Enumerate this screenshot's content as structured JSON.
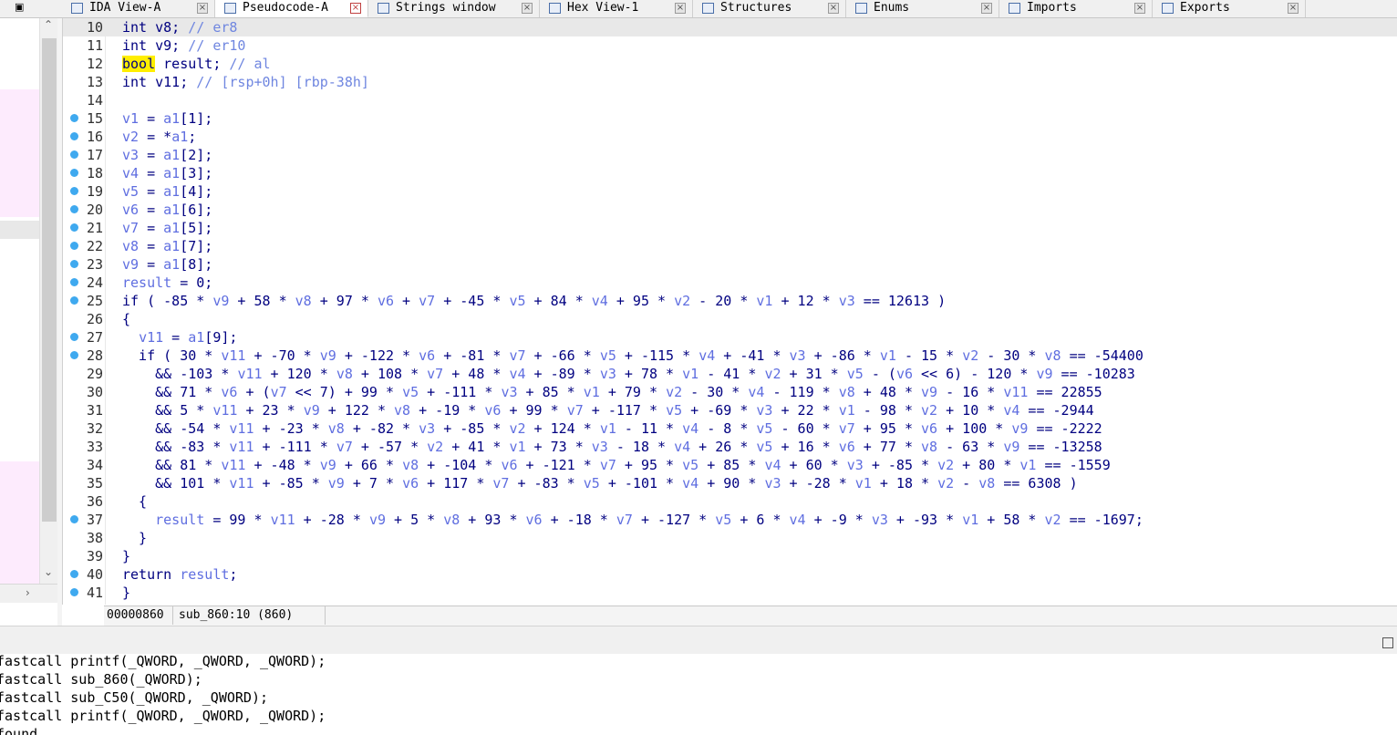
{
  "tabs": [
    {
      "label": "IDA View-A",
      "icon": "disassembly-view-icon",
      "active": false
    },
    {
      "label": "Pseudocode-A",
      "icon": "pseudocode-icon",
      "active": true
    },
    {
      "label": "Strings window",
      "icon": "strings-icon",
      "active": false
    },
    {
      "label": "Hex View-1",
      "icon": "hex-view-icon",
      "active": false
    },
    {
      "label": "Structures",
      "icon": "structures-icon",
      "active": false
    },
    {
      "label": "Enums",
      "icon": "enums-icon",
      "active": false
    },
    {
      "label": "Imports",
      "icon": "imports-icon",
      "active": false
    },
    {
      "label": "Exports",
      "icon": "exports-icon",
      "active": false
    }
  ],
  "close_glyph": "×",
  "restore_glyph": "▣",
  "left_arrows": {
    "up": "⌃",
    "down": "⌄",
    "right": "›"
  },
  "colors": {
    "breakpoint": "#3fa9ef",
    "highlight": "#ffee00",
    "keyword": "#000080",
    "variable": "#5f6ee0",
    "current_line": "#e8e8e8",
    "nav_pink": "#fdebfd"
  },
  "code_lines": [
    {
      "n": "10",
      "bp": false,
      "tokens": [
        [
          "int v8; ",
          "k"
        ],
        [
          "// er8",
          "c"
        ]
      ]
    },
    {
      "n": "11",
      "bp": false,
      "tokens": [
        [
          "int v9; ",
          "k"
        ],
        [
          "// er10",
          "c"
        ]
      ]
    },
    {
      "n": "12",
      "bp": false,
      "tokens": [
        [
          "bool",
          "h"
        ],
        [
          " result; ",
          "k"
        ],
        [
          "// al",
          "c"
        ]
      ]
    },
    {
      "n": "13",
      "bp": false,
      "tokens": [
        [
          "int v11; ",
          "k"
        ],
        [
          "// [rsp+0h] [rbp-38h]",
          "c"
        ]
      ]
    },
    {
      "n": "14",
      "bp": false,
      "tokens": []
    },
    {
      "n": "15",
      "bp": true,
      "tokens": [
        [
          "v1",
          "v"
        ],
        [
          " = ",
          "k"
        ],
        [
          "a1",
          "v"
        ],
        [
          "[1];",
          "k"
        ]
      ]
    },
    {
      "n": "16",
      "bp": true,
      "tokens": [
        [
          "v2",
          "v"
        ],
        [
          " = *",
          "k"
        ],
        [
          "a1",
          "v"
        ],
        [
          ";",
          "k"
        ]
      ]
    },
    {
      "n": "17",
      "bp": true,
      "tokens": [
        [
          "v3",
          "v"
        ],
        [
          " = ",
          "k"
        ],
        [
          "a1",
          "v"
        ],
        [
          "[2];",
          "k"
        ]
      ]
    },
    {
      "n": "18",
      "bp": true,
      "tokens": [
        [
          "v4",
          "v"
        ],
        [
          " = ",
          "k"
        ],
        [
          "a1",
          "v"
        ],
        [
          "[3];",
          "k"
        ]
      ]
    },
    {
      "n": "19",
      "bp": true,
      "tokens": [
        [
          "v5",
          "v"
        ],
        [
          " = ",
          "k"
        ],
        [
          "a1",
          "v"
        ],
        [
          "[4];",
          "k"
        ]
      ]
    },
    {
      "n": "20",
      "bp": true,
      "tokens": [
        [
          "v6",
          "v"
        ],
        [
          " = ",
          "k"
        ],
        [
          "a1",
          "v"
        ],
        [
          "[6];",
          "k"
        ]
      ]
    },
    {
      "n": "21",
      "bp": true,
      "tokens": [
        [
          "v7",
          "v"
        ],
        [
          " = ",
          "k"
        ],
        [
          "a1",
          "v"
        ],
        [
          "[5];",
          "k"
        ]
      ]
    },
    {
      "n": "22",
      "bp": true,
      "tokens": [
        [
          "v8",
          "v"
        ],
        [
          " = ",
          "k"
        ],
        [
          "a1",
          "v"
        ],
        [
          "[7];",
          "k"
        ]
      ]
    },
    {
      "n": "23",
      "bp": true,
      "tokens": [
        [
          "v9",
          "v"
        ],
        [
          " = ",
          "k"
        ],
        [
          "a1",
          "v"
        ],
        [
          "[8];",
          "k"
        ]
      ]
    },
    {
      "n": "24",
      "bp": true,
      "tokens": [
        [
          "result",
          "v"
        ],
        [
          " = 0;",
          "k"
        ]
      ]
    },
    {
      "n": "25",
      "bp": true,
      "tokens": [
        [
          "if ( -85 * ",
          "k"
        ],
        [
          "v9",
          "v"
        ],
        [
          " + 58 * ",
          "k"
        ],
        [
          "v8",
          "v"
        ],
        [
          " + 97 * ",
          "k"
        ],
        [
          "v6",
          "v"
        ],
        [
          " + ",
          "k"
        ],
        [
          "v7",
          "v"
        ],
        [
          " + -45 * ",
          "k"
        ],
        [
          "v5",
          "v"
        ],
        [
          " + 84 * ",
          "k"
        ],
        [
          "v4",
          "v"
        ],
        [
          " + 95 * ",
          "k"
        ],
        [
          "v2",
          "v"
        ],
        [
          " - 20 * ",
          "k"
        ],
        [
          "v1",
          "v"
        ],
        [
          " + 12 * ",
          "k"
        ],
        [
          "v3",
          "v"
        ],
        [
          " == 12613 )",
          "k"
        ]
      ]
    },
    {
      "n": "26",
      "bp": false,
      "tokens": [
        [
          "{",
          "k"
        ]
      ]
    },
    {
      "n": "27",
      "bp": true,
      "tokens": [
        [
          "  ",
          "k"
        ],
        [
          "v11",
          "v"
        ],
        [
          " = ",
          "k"
        ],
        [
          "a1",
          "v"
        ],
        [
          "[9];",
          "k"
        ]
      ]
    },
    {
      "n": "28",
      "bp": true,
      "tokens": [
        [
          "  if ( 30 * ",
          "k"
        ],
        [
          "v11",
          "v"
        ],
        [
          " + -70 * ",
          "k"
        ],
        [
          "v9",
          "v"
        ],
        [
          " + -122 * ",
          "k"
        ],
        [
          "v6",
          "v"
        ],
        [
          " + -81 * ",
          "k"
        ],
        [
          "v7",
          "v"
        ],
        [
          " + -66 * ",
          "k"
        ],
        [
          "v5",
          "v"
        ],
        [
          " + -115 * ",
          "k"
        ],
        [
          "v4",
          "v"
        ],
        [
          " + -41 * ",
          "k"
        ],
        [
          "v3",
          "v"
        ],
        [
          " + -86 * ",
          "k"
        ],
        [
          "v1",
          "v"
        ],
        [
          " - 15 * ",
          "k"
        ],
        [
          "v2",
          "v"
        ],
        [
          " - 30 * ",
          "k"
        ],
        [
          "v8",
          "v"
        ],
        [
          " == -54400",
          "k"
        ]
      ]
    },
    {
      "n": "29",
      "bp": false,
      "tokens": [
        [
          "    && -103 * ",
          "k"
        ],
        [
          "v11",
          "v"
        ],
        [
          " + 120 * ",
          "k"
        ],
        [
          "v8",
          "v"
        ],
        [
          " + 108 * ",
          "k"
        ],
        [
          "v7",
          "v"
        ],
        [
          " + 48 * ",
          "k"
        ],
        [
          "v4",
          "v"
        ],
        [
          " + -89 * ",
          "k"
        ],
        [
          "v3",
          "v"
        ],
        [
          " + 78 * ",
          "k"
        ],
        [
          "v1",
          "v"
        ],
        [
          " - 41 * ",
          "k"
        ],
        [
          "v2",
          "v"
        ],
        [
          " + 31 * ",
          "k"
        ],
        [
          "v5",
          "v"
        ],
        [
          " - (",
          "k"
        ],
        [
          "v6",
          "v"
        ],
        [
          " << 6) - 120 * ",
          "k"
        ],
        [
          "v9",
          "v"
        ],
        [
          " == -10283",
          "k"
        ]
      ]
    },
    {
      "n": "30",
      "bp": false,
      "tokens": [
        [
          "    && 71 * ",
          "k"
        ],
        [
          "v6",
          "v"
        ],
        [
          " + (",
          "k"
        ],
        [
          "v7",
          "v"
        ],
        [
          " << 7) + 99 * ",
          "k"
        ],
        [
          "v5",
          "v"
        ],
        [
          " + -111 * ",
          "k"
        ],
        [
          "v3",
          "v"
        ],
        [
          " + 85 * ",
          "k"
        ],
        [
          "v1",
          "v"
        ],
        [
          " + 79 * ",
          "k"
        ],
        [
          "v2",
          "v"
        ],
        [
          " - 30 * ",
          "k"
        ],
        [
          "v4",
          "v"
        ],
        [
          " - 119 * ",
          "k"
        ],
        [
          "v8",
          "v"
        ],
        [
          " + 48 * ",
          "k"
        ],
        [
          "v9",
          "v"
        ],
        [
          " - 16 * ",
          "k"
        ],
        [
          "v11",
          "v"
        ],
        [
          " == 22855",
          "k"
        ]
      ]
    },
    {
      "n": "31",
      "bp": false,
      "tokens": [
        [
          "    && 5 * ",
          "k"
        ],
        [
          "v11",
          "v"
        ],
        [
          " + 23 * ",
          "k"
        ],
        [
          "v9",
          "v"
        ],
        [
          " + 122 * ",
          "k"
        ],
        [
          "v8",
          "v"
        ],
        [
          " + -19 * ",
          "k"
        ],
        [
          "v6",
          "v"
        ],
        [
          " + 99 * ",
          "k"
        ],
        [
          "v7",
          "v"
        ],
        [
          " + -117 * ",
          "k"
        ],
        [
          "v5",
          "v"
        ],
        [
          " + -69 * ",
          "k"
        ],
        [
          "v3",
          "v"
        ],
        [
          " + 22 * ",
          "k"
        ],
        [
          "v1",
          "v"
        ],
        [
          " - 98 * ",
          "k"
        ],
        [
          "v2",
          "v"
        ],
        [
          " + 10 * ",
          "k"
        ],
        [
          "v4",
          "v"
        ],
        [
          " == -2944",
          "k"
        ]
      ]
    },
    {
      "n": "32",
      "bp": false,
      "tokens": [
        [
          "    && -54 * ",
          "k"
        ],
        [
          "v11",
          "v"
        ],
        [
          " + -23 * ",
          "k"
        ],
        [
          "v8",
          "v"
        ],
        [
          " + -82 * ",
          "k"
        ],
        [
          "v3",
          "v"
        ],
        [
          " + -85 * ",
          "k"
        ],
        [
          "v2",
          "v"
        ],
        [
          " + 124 * ",
          "k"
        ],
        [
          "v1",
          "v"
        ],
        [
          " - 11 * ",
          "k"
        ],
        [
          "v4",
          "v"
        ],
        [
          " - 8 * ",
          "k"
        ],
        [
          "v5",
          "v"
        ],
        [
          " - 60 * ",
          "k"
        ],
        [
          "v7",
          "v"
        ],
        [
          " + 95 * ",
          "k"
        ],
        [
          "v6",
          "v"
        ],
        [
          " + 100 * ",
          "k"
        ],
        [
          "v9",
          "v"
        ],
        [
          " == -2222",
          "k"
        ]
      ]
    },
    {
      "n": "33",
      "bp": false,
      "tokens": [
        [
          "    && -83 * ",
          "k"
        ],
        [
          "v11",
          "v"
        ],
        [
          " + -111 * ",
          "k"
        ],
        [
          "v7",
          "v"
        ],
        [
          " + -57 * ",
          "k"
        ],
        [
          "v2",
          "v"
        ],
        [
          " + 41 * ",
          "k"
        ],
        [
          "v1",
          "v"
        ],
        [
          " + 73 * ",
          "k"
        ],
        [
          "v3",
          "v"
        ],
        [
          " - 18 * ",
          "k"
        ],
        [
          "v4",
          "v"
        ],
        [
          " + 26 * ",
          "k"
        ],
        [
          "v5",
          "v"
        ],
        [
          " + 16 * ",
          "k"
        ],
        [
          "v6",
          "v"
        ],
        [
          " + 77 * ",
          "k"
        ],
        [
          "v8",
          "v"
        ],
        [
          " - 63 * ",
          "k"
        ],
        [
          "v9",
          "v"
        ],
        [
          " == -13258",
          "k"
        ]
      ]
    },
    {
      "n": "34",
      "bp": false,
      "tokens": [
        [
          "    && 81 * ",
          "k"
        ],
        [
          "v11",
          "v"
        ],
        [
          " + -48 * ",
          "k"
        ],
        [
          "v9",
          "v"
        ],
        [
          " + 66 * ",
          "k"
        ],
        [
          "v8",
          "v"
        ],
        [
          " + -104 * ",
          "k"
        ],
        [
          "v6",
          "v"
        ],
        [
          " + -121 * ",
          "k"
        ],
        [
          "v7",
          "v"
        ],
        [
          " + 95 * ",
          "k"
        ],
        [
          "v5",
          "v"
        ],
        [
          " + 85 * ",
          "k"
        ],
        [
          "v4",
          "v"
        ],
        [
          " + 60 * ",
          "k"
        ],
        [
          "v3",
          "v"
        ],
        [
          " + -85 * ",
          "k"
        ],
        [
          "v2",
          "v"
        ],
        [
          " + 80 * ",
          "k"
        ],
        [
          "v1",
          "v"
        ],
        [
          " == -1559",
          "k"
        ]
      ]
    },
    {
      "n": "35",
      "bp": false,
      "tokens": [
        [
          "    && 101 * ",
          "k"
        ],
        [
          "v11",
          "v"
        ],
        [
          " + -85 * ",
          "k"
        ],
        [
          "v9",
          "v"
        ],
        [
          " + 7 * ",
          "k"
        ],
        [
          "v6",
          "v"
        ],
        [
          " + 117 * ",
          "k"
        ],
        [
          "v7",
          "v"
        ],
        [
          " + -83 * ",
          "k"
        ],
        [
          "v5",
          "v"
        ],
        [
          " + -101 * ",
          "k"
        ],
        [
          "v4",
          "v"
        ],
        [
          " + 90 * ",
          "k"
        ],
        [
          "v3",
          "v"
        ],
        [
          " + -28 * ",
          "k"
        ],
        [
          "v1",
          "v"
        ],
        [
          " + 18 * ",
          "k"
        ],
        [
          "v2",
          "v"
        ],
        [
          " - ",
          "k"
        ],
        [
          "v8",
          "v"
        ],
        [
          " == 6308 )",
          "k"
        ]
      ]
    },
    {
      "n": "36",
      "bp": false,
      "tokens": [
        [
          "  {",
          "k"
        ]
      ]
    },
    {
      "n": "37",
      "bp": true,
      "tokens": [
        [
          "    ",
          "k"
        ],
        [
          "result",
          "v"
        ],
        [
          " = 99 * ",
          "k"
        ],
        [
          "v11",
          "v"
        ],
        [
          " + -28 * ",
          "k"
        ],
        [
          "v9",
          "v"
        ],
        [
          " + 5 * ",
          "k"
        ],
        [
          "v8",
          "v"
        ],
        [
          " + 93 * ",
          "k"
        ],
        [
          "v6",
          "v"
        ],
        [
          " + -18 * ",
          "k"
        ],
        [
          "v7",
          "v"
        ],
        [
          " + -127 * ",
          "k"
        ],
        [
          "v5",
          "v"
        ],
        [
          " + 6 * ",
          "k"
        ],
        [
          "v4",
          "v"
        ],
        [
          " + -9 * ",
          "k"
        ],
        [
          "v3",
          "v"
        ],
        [
          " + -93 * ",
          "k"
        ],
        [
          "v1",
          "v"
        ],
        [
          " + 58 * ",
          "k"
        ],
        [
          "v2",
          "v"
        ],
        [
          " == -1697;",
          "k"
        ]
      ]
    },
    {
      "n": "38",
      "bp": false,
      "tokens": [
        [
          "  }",
          "k"
        ]
      ]
    },
    {
      "n": "39",
      "bp": false,
      "tokens": [
        [
          "}",
          "k"
        ]
      ]
    },
    {
      "n": "40",
      "bp": true,
      "tokens": [
        [
          "return ",
          "k"
        ],
        [
          "result",
          "v"
        ],
        [
          ";",
          "k"
        ]
      ]
    },
    {
      "n": "41",
      "bp": true,
      "tokens": [
        [
          "}",
          "k"
        ]
      ]
    }
  ],
  "status": {
    "address": "00000860",
    "location": "sub_860:10 (860)"
  },
  "output_lines": [
    "fastcall printf(_QWORD, _QWORD, _QWORD);",
    "fastcall sub_860(_QWORD);",
    "fastcall sub_C50(_QWORD, _QWORD);",
    "fastcall printf(_QWORD, _QWORD, _QWORD);",
    "found"
  ]
}
